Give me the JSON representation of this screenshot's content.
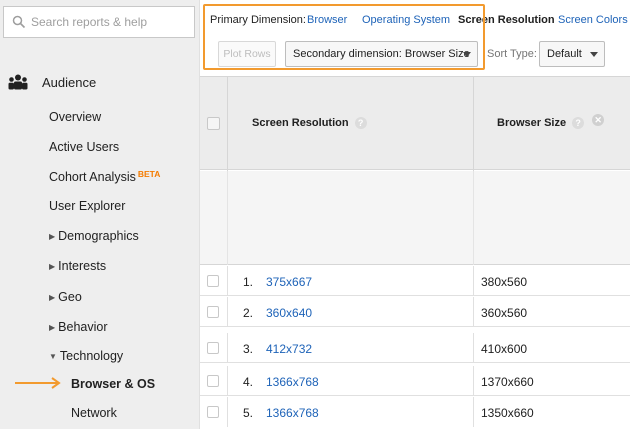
{
  "sidebar": {
    "search_placeholder": "Search reports & help",
    "section_label": "Audience",
    "items": [
      {
        "label": "Overview"
      },
      {
        "label": "Active Users"
      },
      {
        "label": "Cohort Analysis",
        "badge": "BETA"
      },
      {
        "label": "User Explorer"
      },
      {
        "label": "Demographics"
      },
      {
        "label": "Interests"
      },
      {
        "label": "Geo"
      },
      {
        "label": "Behavior"
      },
      {
        "label": "Technology"
      },
      {
        "label": "Browser & OS"
      },
      {
        "label": "Network"
      }
    ]
  },
  "dimensions": {
    "label": "Primary Dimension:",
    "options": [
      "Browser",
      "Operating System",
      "Screen Resolution",
      "Screen Colors"
    ],
    "selected": "Screen Resolution"
  },
  "toolbar": {
    "plot_rows": "Plot Rows",
    "secondary_dimension": "Secondary dimension: Browser Size",
    "sort_type_label": "Sort Type:",
    "sort_type_value": "Default"
  },
  "table": {
    "columns": [
      "Screen Resolution",
      "Browser Size"
    ],
    "rows": [
      {
        "num": "1.",
        "resolution": "375x667",
        "browser_size": "380x560"
      },
      {
        "num": "2.",
        "resolution": "360x640",
        "browser_size": "360x560"
      },
      {
        "num": "3.",
        "resolution": "412x732",
        "browser_size": "410x600"
      },
      {
        "num": "4.",
        "resolution": "1366x768",
        "browser_size": "1370x660"
      },
      {
        "num": "5.",
        "resolution": "1366x768",
        "browser_size": "1350x660"
      }
    ]
  },
  "colors": {
    "accent": "#1e63b8",
    "highlight": "#f29a2e",
    "beta": "#f57c00"
  }
}
